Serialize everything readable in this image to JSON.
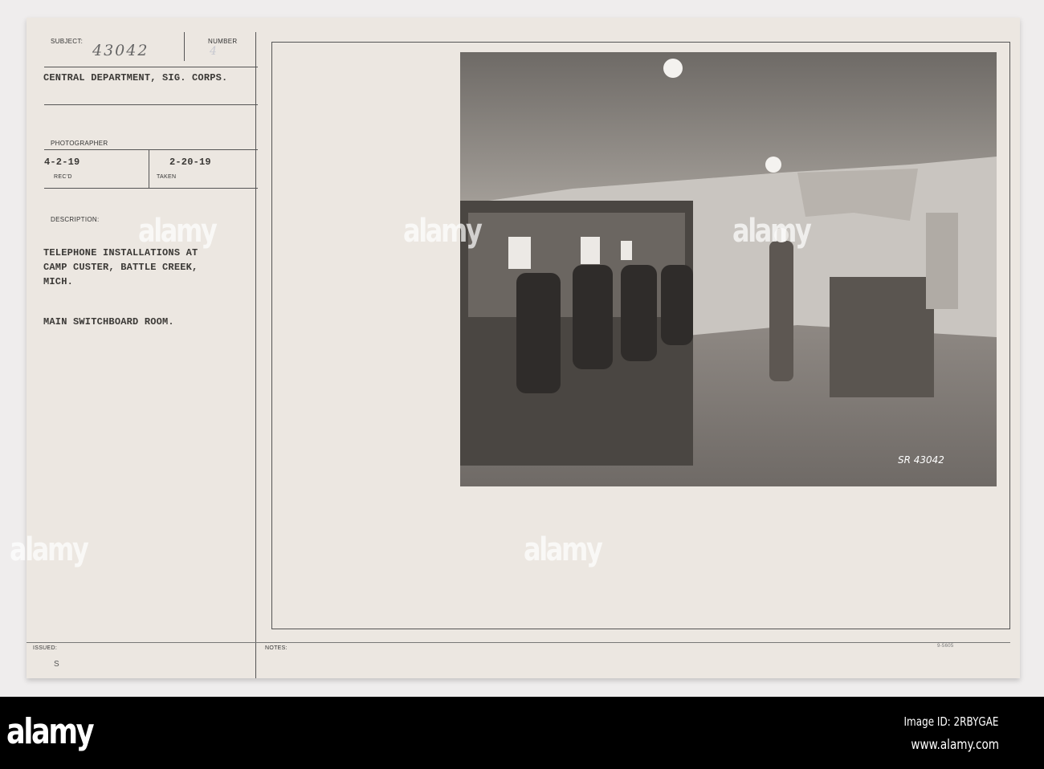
{
  "card": {
    "subject_label": "SUBJECT:",
    "subject_number": "43042",
    "number_label": "NUMBER",
    "number_value": "4",
    "department": "CENTRAL DEPARTMENT, SIG. CORPS.",
    "photographer_label": "PHOTOGRAPHER",
    "received_date": "4-2-19",
    "received_label": "REC'D",
    "taken_date": "2-20-19",
    "taken_label": "TAKEN",
    "description_label": "DESCRIPTION:",
    "description_lines": [
      "TELEPHONE INSTALLATIONS AT",
      "CAMP CUSTER, BATTLE CREEK,",
      "MICH."
    ],
    "caption": "MAIN SWITCHBOARD ROOM.",
    "issued_label": "ISSUED:",
    "issued_mark": "S",
    "notes_label": "NOTES:",
    "form_number": "9-5605"
  },
  "photo": {
    "negative_number": "SR 43042"
  },
  "watermark": {
    "logo": "alamy",
    "image_id": "Image ID: 2RBYGAE",
    "url": "www.alamy.com"
  }
}
